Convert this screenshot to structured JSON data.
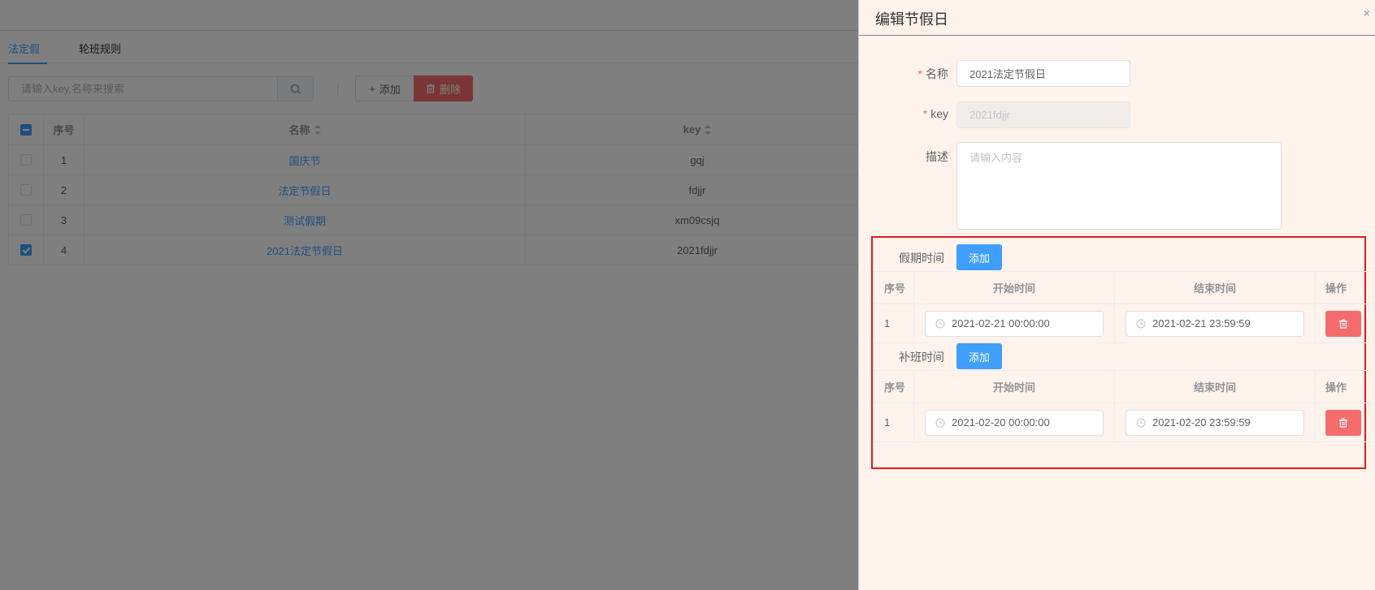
{
  "tabs": [
    {
      "label": "法定假期",
      "active": true
    },
    {
      "label": "轮班规则",
      "active": false
    }
  ],
  "toolbar": {
    "search_placeholder": "请输入key,名称来搜索",
    "add_label": "添加",
    "delete_label": "删除"
  },
  "table": {
    "columns": [
      "序号",
      "名称",
      "key"
    ],
    "rows": [
      {
        "index": "1",
        "name": "国庆节",
        "key": "gqj",
        "checked": false
      },
      {
        "index": "2",
        "name": "法定节假日",
        "key": "fdjjr",
        "checked": false
      },
      {
        "index": "3",
        "name": "测试假期",
        "key": "xm09csjq",
        "checked": false
      },
      {
        "index": "4",
        "name": "2021法定节假日",
        "key": "2021fdjjr",
        "checked": true
      }
    ]
  },
  "drawer": {
    "title": "编辑节假日",
    "close_glyph": "×",
    "form": {
      "name_label": "名称",
      "name_value": "2021法定节假日",
      "key_label": "key",
      "key_value": "2021fdjjr",
      "desc_label": "描述",
      "desc_placeholder": "请输入内容",
      "required_mark": "*"
    },
    "holiday_section": {
      "label": "假期时间",
      "add_label": "添加",
      "columns": [
        "序号",
        "开始时间",
        "结束时间",
        "操作"
      ],
      "rows": [
        {
          "index": "1",
          "start": "2021-02-21 00:00:00",
          "end": "2021-02-21 23:59:59"
        }
      ]
    },
    "workday_section": {
      "label": "补班时间",
      "add_label": "添加",
      "columns": [
        "序号",
        "开始时间",
        "结束时间",
        "操作"
      ],
      "rows": [
        {
          "index": "1",
          "start": "2021-02-20 00:00:00",
          "end": "2021-02-20 23:59:59"
        }
      ]
    }
  },
  "colors": {
    "primary": "#409eff",
    "danger": "#f56c6c",
    "highlight": "#e5191a",
    "drawer_bg": "#fff3eb"
  }
}
